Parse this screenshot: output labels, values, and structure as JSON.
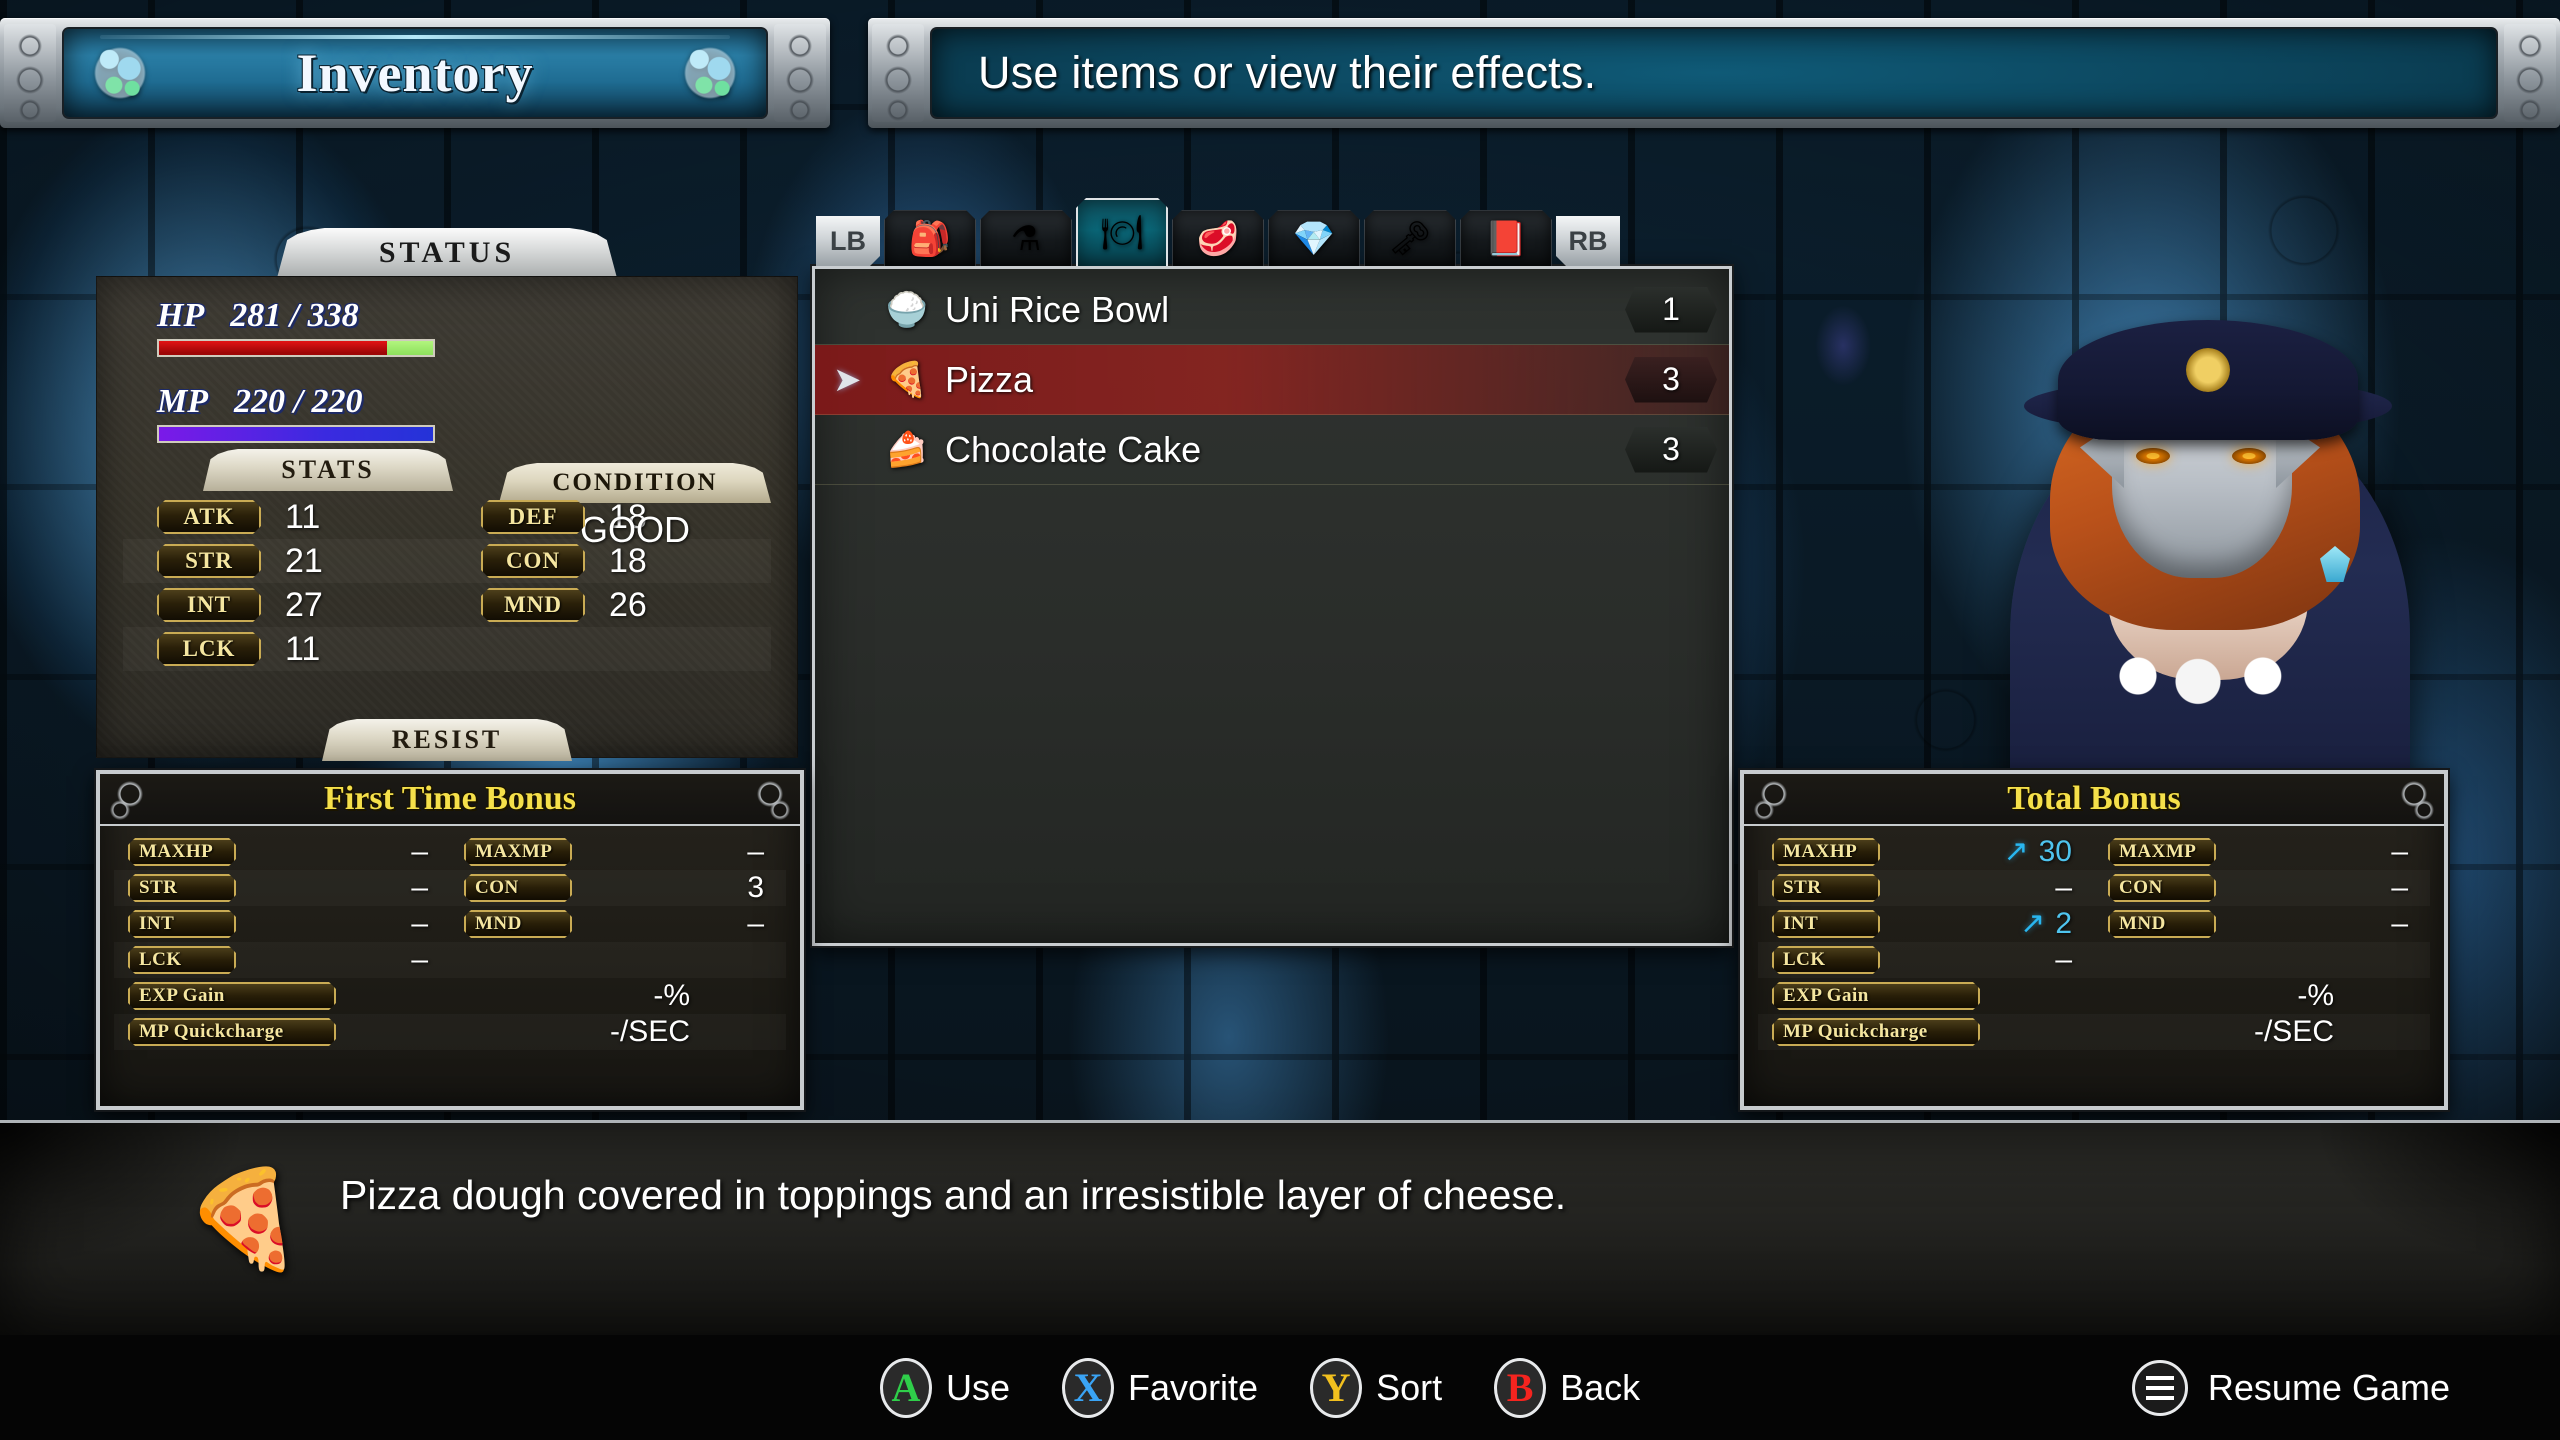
{
  "window": {
    "title": "Inventory",
    "message": "Use items or view their effects."
  },
  "status": {
    "header": "STATUS",
    "hp": {
      "label": "HP",
      "value": "281 / 338",
      "current": 281,
      "max": 338
    },
    "mp": {
      "label": "MP",
      "value": "220 / 220",
      "current": 220,
      "max": 220
    },
    "condition": {
      "header": "CONDITION",
      "value": "GOOD"
    },
    "stats_header": "STATS",
    "resist_header": "RESIST",
    "stats": [
      {
        "left_label": "ATK",
        "left_value": "11",
        "right_label": "DEF",
        "right_value": "18"
      },
      {
        "left_label": "STR",
        "left_value": "21",
        "right_label": "CON",
        "right_value": "18"
      },
      {
        "left_label": "INT",
        "left_value": "27",
        "right_label": "MND",
        "right_value": "26"
      },
      {
        "left_label": "LCK",
        "left_value": "11",
        "right_label": "",
        "right_value": ""
      }
    ]
  },
  "tabs": {
    "left_bumper": "LB",
    "right_bumper": "RB",
    "categories": [
      {
        "name": "bag-icon",
        "glyph": "🎒",
        "active": false
      },
      {
        "name": "potion-icon",
        "glyph": "⚗",
        "active": false
      },
      {
        "name": "food-plate-icon",
        "glyph": "🍽",
        "active": true
      },
      {
        "name": "meat-icon",
        "glyph": "🥩",
        "active": false
      },
      {
        "name": "crystal-icon",
        "glyph": "💎",
        "active": false
      },
      {
        "name": "key-icon",
        "glyph": "🗝",
        "active": false
      },
      {
        "name": "book-icon",
        "glyph": "📕",
        "active": false
      }
    ]
  },
  "items": [
    {
      "icon": "🍚",
      "name": "Uni Rice Bowl",
      "count": "1",
      "selected": false
    },
    {
      "icon": "🍕",
      "name": "Pizza",
      "count": "3",
      "selected": true
    },
    {
      "icon": "🍰",
      "name": "Chocolate Cake",
      "count": "3",
      "selected": false
    }
  ],
  "first_time_bonus": {
    "title": "First Time Bonus",
    "rows": [
      {
        "left_label": "MAXHP",
        "left_value": "–",
        "left_up": false,
        "right_label": "MAXMP",
        "right_value": "–",
        "right_up": false
      },
      {
        "left_label": "STR",
        "left_value": "–",
        "left_up": false,
        "right_label": "CON",
        "right_value": "3",
        "right_up": false
      },
      {
        "left_label": "INT",
        "left_value": "–",
        "left_up": false,
        "right_label": "MND",
        "right_value": "–",
        "right_up": false
      },
      {
        "left_label": "LCK",
        "left_value": "–",
        "left_up": false,
        "right_label": "",
        "right_value": "",
        "right_up": false
      }
    ],
    "exp_label": "EXP Gain",
    "exp_value": "-%",
    "mpq_label": "MP Quickcharge",
    "mpq_value": "-/SEC"
  },
  "total_bonus": {
    "title": "Total Bonus",
    "rows": [
      {
        "left_label": "MAXHP",
        "left_value": "30",
        "left_up": true,
        "right_label": "MAXMP",
        "right_value": "–",
        "right_up": false
      },
      {
        "left_label": "STR",
        "left_value": "–",
        "left_up": false,
        "right_label": "CON",
        "right_value": "–",
        "right_up": false
      },
      {
        "left_label": "INT",
        "left_value": "2",
        "left_up": true,
        "right_label": "MND",
        "right_value": "–",
        "right_up": false
      },
      {
        "left_label": "LCK",
        "left_value": "–",
        "left_up": false,
        "right_label": "",
        "right_value": "",
        "right_up": false
      }
    ],
    "exp_label": "EXP Gain",
    "exp_value": "-%",
    "mpq_label": "MP Quickcharge",
    "mpq_value": "-/SEC"
  },
  "description": {
    "icon": "🍕",
    "text": "Pizza dough covered in toppings and an irresistible layer of cheese."
  },
  "footer": {
    "prompts": [
      {
        "button": "A",
        "label": "Use",
        "color": "#2fcf4a"
      },
      {
        "button": "X",
        "label": "Favorite",
        "color": "#3aa4f5"
      },
      {
        "button": "Y",
        "label": "Sort",
        "color": "#f2c01e"
      },
      {
        "button": "B",
        "label": "Back",
        "color": "#f5241f"
      }
    ],
    "resume_label": "Resume Game"
  },
  "colors": {
    "hp_bar": "#e21414",
    "hp_remaining": "#8de05c",
    "mp_bar": "#3b2ae0",
    "gold_text": "#f5e04a",
    "up_arrow": "#29b6ef",
    "selection": "#8d1a1a"
  }
}
